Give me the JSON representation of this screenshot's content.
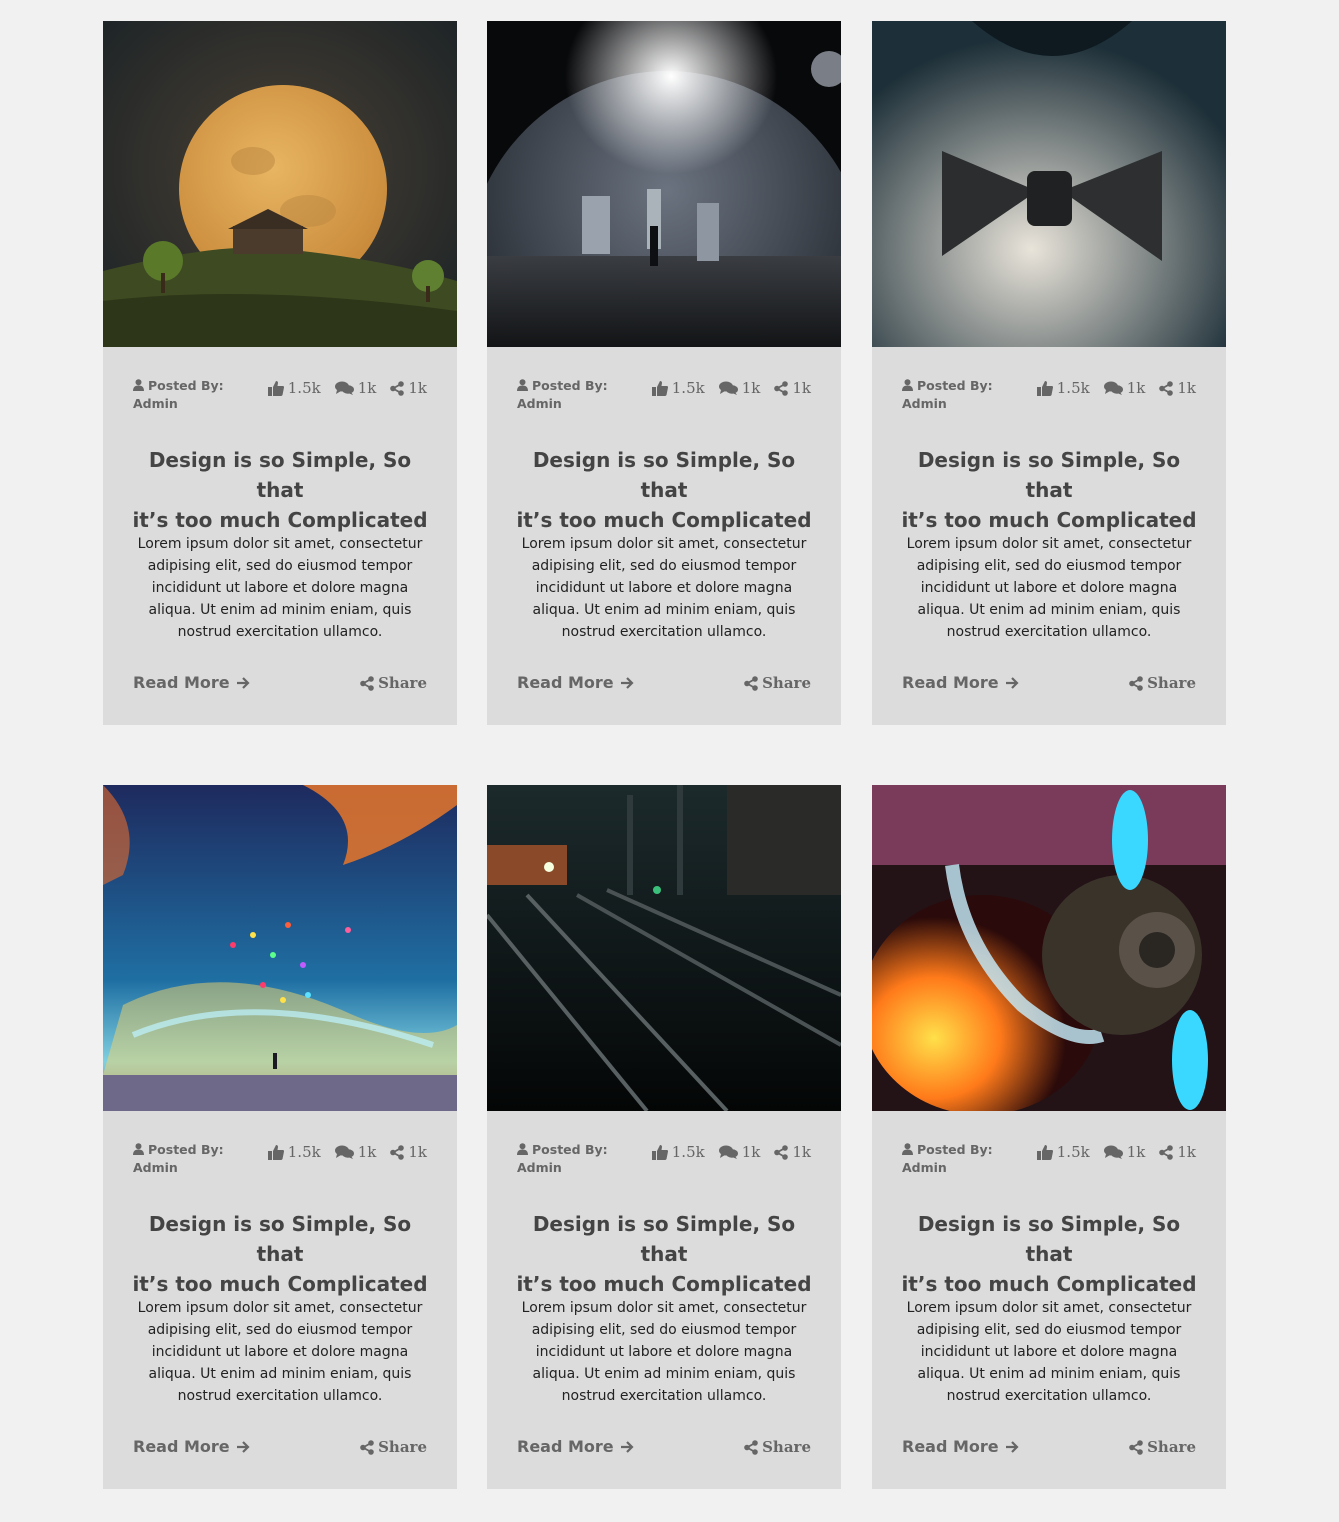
{
  "posts": [
    {
      "image": "full-moon-house-on-hill",
      "posted_by_label": "Posted By:",
      "author": "Admin",
      "likes": "1.5k",
      "comments": "1k",
      "shares": "1k",
      "title_line1": "Design is so Simple, So that",
      "title_line2": "it’s too much Complicated",
      "excerpt": "Lorem ipsum dolor sit amet, consectetur adipising elit, sed do eiusmod tempor incididunt ut labore et dolore magna aliqua. Ut enim ad minim eniam, quis nostrud exercitation ullamco.",
      "read_more": "Read More",
      "share_label": "Share"
    },
    {
      "image": "planet-over-dark-landscape",
      "posted_by_label": "Posted By:",
      "author": "Admin",
      "likes": "1.5k",
      "comments": "1k",
      "shares": "1k",
      "title_line1": "Design is so Simple, So that",
      "title_line2": "it’s too much Complicated",
      "excerpt": "Lorem ipsum dolor sit amet, consectetur adipising elit, sed do eiusmod tempor incididunt ut labore et dolore magna aliqua. Ut enim ad minim eniam, quis nostrud exercitation ullamco.",
      "read_more": "Read More",
      "share_label": "Share"
    },
    {
      "image": "man-with-bow-tie",
      "posted_by_label": "Posted By:",
      "author": "Admin",
      "likes": "1.5k",
      "comments": "1k",
      "shares": "1k",
      "title_line1": "Design is so Simple, So that",
      "title_line2": "it’s too much Complicated",
      "excerpt": "Lorem ipsum dolor sit amet, consectetur adipising elit, sed do eiusmod tempor incididunt ut labore et dolore magna aliqua. Ut enim ad minim eniam, quis nostrud exercitation ullamco.",
      "read_more": "Read More",
      "share_label": "Share"
    },
    {
      "image": "painted-sky-balloons",
      "posted_by_label": "Posted By:",
      "author": "Admin",
      "likes": "1.5k",
      "comments": "1k",
      "shares": "1k",
      "title_line1": "Design is so Simple, So that",
      "title_line2": "it’s too much Complicated",
      "excerpt": "Lorem ipsum dolor sit amet, consectetur adipising elit, sed do eiusmod tempor incididunt ut labore et dolore magna aliqua. Ut enim ad minim eniam, quis nostrud exercitation ullamco.",
      "read_more": "Read More",
      "share_label": "Share"
    },
    {
      "image": "railway-tracks-at-night",
      "posted_by_label": "Posted By:",
      "author": "Admin",
      "likes": "1.5k",
      "comments": "1k",
      "shares": "1k",
      "title_line1": "Design is so Simple, So that",
      "title_line2": "it’s too much Complicated",
      "excerpt": "Lorem ipsum dolor sit amet, consectetur adipising elit, sed do eiusmod tempor incididunt ut labore et dolore magna aliqua. Ut enim ad minim eniam, quis nostrud exercitation ullamco.",
      "read_more": "Read More",
      "share_label": "Share"
    },
    {
      "image": "fiery-propeller-engine",
      "posted_by_label": "Posted By:",
      "author": "Admin",
      "likes": "1.5k",
      "comments": "1k",
      "shares": "1k",
      "title_line1": "Design is so Simple, So that",
      "title_line2": "it’s too much Complicated",
      "excerpt": "Lorem ipsum dolor sit amet, consectetur adipising elit, sed do eiusmod tempor incididunt ut labore et dolore magna aliqua. Ut enim ad minim eniam, quis nostrud exercitation ullamco.",
      "read_more": "Read More",
      "share_label": "Share"
    }
  ],
  "colors": {
    "page_bg": "#f1f1f1",
    "card_bg": "#dcdcdc",
    "meta_text": "#666666",
    "title_text": "#444444"
  }
}
